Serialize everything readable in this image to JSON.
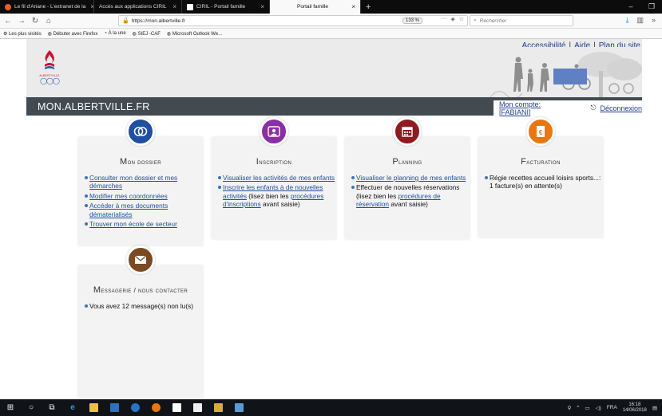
{
  "browser": {
    "tabs": [
      {
        "title": "Le fil d'Ariane - L'extranet de la",
        "fav": "#e85d2a"
      },
      {
        "title": "Accès aux applications CIRIL",
        "fav": ""
      },
      {
        "title": "CIRIL - Portail famille",
        "fav": "#ffffff"
      },
      {
        "title": "Portail famille",
        "fav": "",
        "active": true
      }
    ],
    "new_tab": "+",
    "url": "https://mon.albertville.fr",
    "zoom": "133 %",
    "search_placeholder": "Rechercher",
    "bookmarks": [
      "Les plus visités",
      "Débuter avec Firefox",
      "À la une",
      "SIEJ -CAF",
      "Microsoft Outlook We..."
    ]
  },
  "header": {
    "links": [
      "Accessibilité",
      "Aide",
      "Plan du site"
    ],
    "separator": "|",
    "logo_text": "ALBERTVILLE",
    "site_name": "MON.ALBERTVILLE.FR",
    "account_label": "Mon compte: [FABIANI]",
    "logout_label": "Déconnexion"
  },
  "cards": [
    {
      "title_first": "M",
      "title_rest": "on dossier",
      "color": "#1e4fa0",
      "icon": "users-icon",
      "items": [
        {
          "link": "Consulter mon dossier et mes démarches"
        },
        {
          "link": "Modifier mes coordonnées"
        },
        {
          "link": "Accéder à mes documents dématerialisés"
        },
        {
          "link": "Trouver mon école de secteur"
        }
      ]
    },
    {
      "title_first": "I",
      "title_rest": "nscription",
      "color": "#8b2fa3",
      "icon": "child-icon",
      "items": [
        {
          "link": "Visualiser les activités de mes enfants"
        },
        {
          "link": "Inscrire les enfants à de nouvelles activités",
          "text": " (lisez bien les ",
          "link2": "procédures d'inscriptions",
          "text2": " avant saisie)"
        }
      ]
    },
    {
      "title_first": "P",
      "title_rest": "lanning",
      "color": "#8e1b22",
      "icon": "calendar-icon",
      "items": [
        {
          "link": "Visualiser le planning de mes enfants"
        },
        {
          "text": "Effectuer de nouvelles réservations (lisez bien les ",
          "link2": "procédures de réservation",
          "text2": " avant saisie)"
        }
      ]
    },
    {
      "title_first": "F",
      "title_rest": "acturation",
      "color": "#e8770f",
      "icon": "invoice-icon",
      "items": [
        {
          "text": "Régie recettes accueil loisirs sports...: 1 facture(s) en attente(s)"
        }
      ]
    },
    {
      "title_first": "M",
      "title_rest": "essagerie / nous contacter",
      "color": "#7a4a22",
      "icon": "envelope-icon",
      "items": [
        {
          "text": "Vous avez 12 message(s) non lu(s)"
        }
      ]
    }
  ],
  "taskbar": {
    "language": "FRA",
    "time": "16:18",
    "date": "14/06/2018"
  }
}
